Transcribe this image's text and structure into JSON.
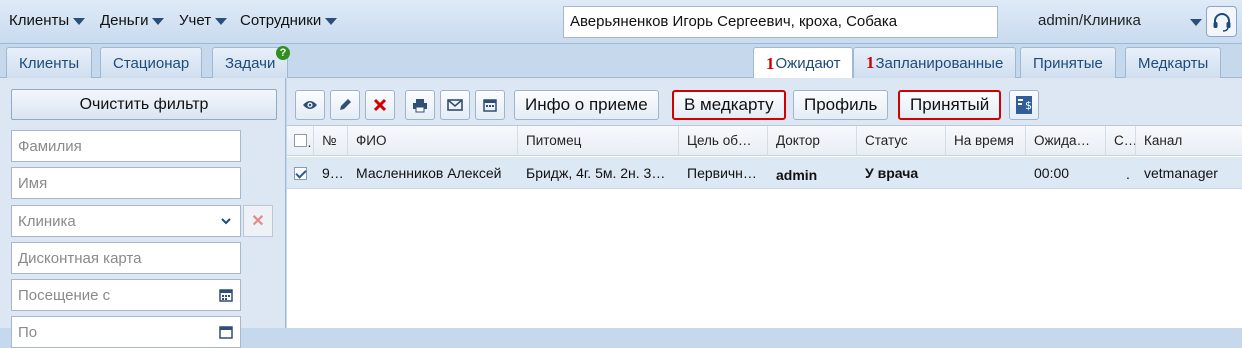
{
  "menu": {
    "clients": "Клиенты",
    "money": "Деньги",
    "accounting": "Учет",
    "staff": "Сотрудники"
  },
  "search": {
    "value": "Аверьяненков Игорь Сергеевич, кроха, Собака"
  },
  "user": {
    "label": "admin/Клиника"
  },
  "tabs_left": [
    "Клиенты",
    "Стационар",
    "Задачи"
  ],
  "tabs_right": [
    {
      "count": "1",
      "label": "Ожидают"
    },
    {
      "count": "1",
      "label": "Запланированные"
    },
    {
      "count": "",
      "label": "Принятые"
    },
    {
      "count": "",
      "label": "Медкарты"
    }
  ],
  "help_badge": "?",
  "filter": {
    "clear_label": "Очистить фильтр",
    "lastname_placeholder": "Фамилия",
    "firstname_placeholder": "Имя",
    "clinic_placeholder": "Клиника",
    "discount_placeholder": "Дисконтная карта",
    "visit_from_placeholder": "Посещение с",
    "visit_to_placeholder": "По"
  },
  "toolbar": {
    "visit_info": "Инфо о приеме",
    "to_medcard": "В медкарту",
    "profile": "Профиль",
    "accepted": "Принятый"
  },
  "table": {
    "headers": [
      "№",
      "ФИО",
      "Питомец",
      "Цель об…",
      "Доктор",
      "Статус",
      "На время",
      "Ожида…",
      "С…",
      "Канал"
    ],
    "rows": [
      {
        "checked": true,
        "num": "9…",
        "fio": "Масленников Алексей",
        "pet": "Бридж, 4г. 5м. 2н. 3…",
        "purpose": "Первичн…",
        "doctor": "admin",
        "status": "У врача",
        "time": "",
        "wait": "00:00",
        "c": ".",
        "channel": "vetmanager"
      }
    ]
  },
  "colors": {
    "accent": "#1d4b7a",
    "highlight": "#d40000",
    "row_selected": "#dde8f5"
  }
}
